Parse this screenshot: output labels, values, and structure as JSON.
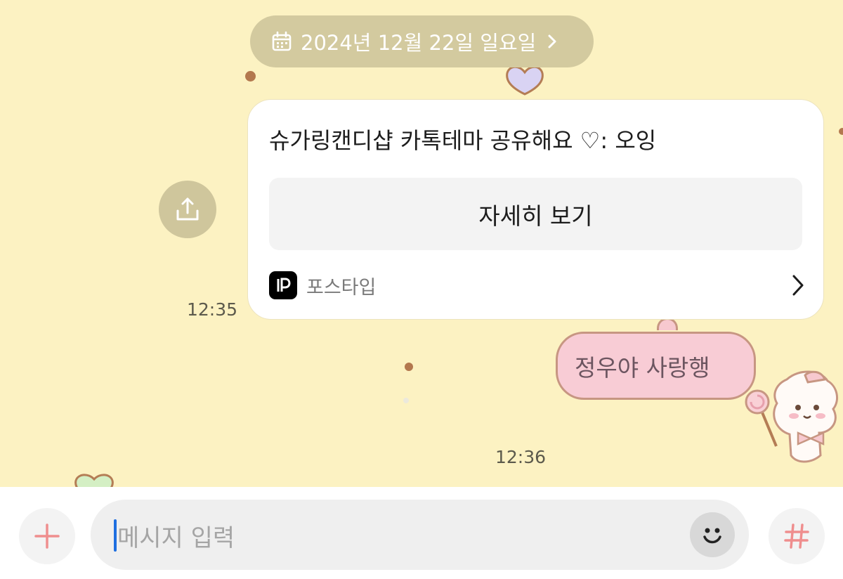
{
  "date_header": {
    "text": "2024년 12월 22일 일요일",
    "icon": "calendar-icon"
  },
  "link_card": {
    "title": "슈가링캔디샵 카톡테마 공유해요 ♡: 오잉",
    "button_label": "자세히 보기",
    "source_name": "포스타입",
    "source_logo_text": "P"
  },
  "messages": [
    {
      "type": "received-link",
      "time": "12:35"
    },
    {
      "type": "sent",
      "text": "정우야 사랑행",
      "time": "12:36"
    }
  ],
  "input": {
    "placeholder": "메시지 입력"
  },
  "colors": {
    "chat_background": "#fcf2c2",
    "date_pill": "#d3ca9f",
    "sent_bubble": "#f8ccd5",
    "accent_pink": "#ef8e8e"
  }
}
